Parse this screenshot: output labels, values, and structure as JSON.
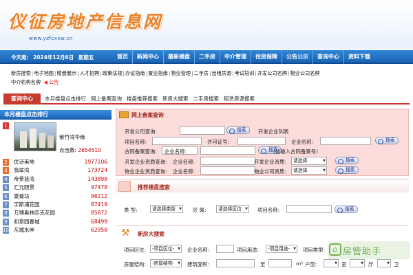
{
  "header": {
    "logo_text": "仪征房地产信息网",
    "url": "www.yzfcxxw.cn"
  },
  "topbar": {
    "today_label": "今天是:",
    "date": "2024年12月6日",
    "weekday": "星期五",
    "nav": [
      "首页",
      "新闻中心",
      "最新楼盘",
      "二手房",
      "中介管理",
      "住房保障",
      "公告公示",
      "查询中心",
      "资料下载"
    ]
  },
  "links": {
    "row1": [
      "新房搜索",
      "电子地图",
      "楼盘展示",
      "人才招聘",
      "政策法规",
      "办证指南",
      "置业指南",
      "物业管理",
      "二手房",
      "出租房源",
      "考试培训",
      "开发公司名牌",
      "物业公司名牌"
    ],
    "row2_first": "中介机构名牌",
    "notice": "公告"
  },
  "search_tabs": {
    "active": "查询中心",
    "tabs": [
      "本月楼盘点击排行",
      "网上备案查询",
      "楼盘推荐搜索",
      "新房大搜索",
      "二手房搜索",
      "租赁房源搜索"
    ]
  },
  "ranking": {
    "title": "本月楼盘点击排行",
    "featured": {
      "rank": "1",
      "name": "紫竹湾华缘",
      "clicks_label": "点击数:",
      "clicks": "2654510"
    },
    "items": [
      {
        "rank": "2",
        "name": "优诗美地",
        "count": "1977106"
      },
      {
        "rank": "3",
        "name": "翡翠湾",
        "count": "173724"
      },
      {
        "rank": "4",
        "name": "帝景蓝湾",
        "count": "143898"
      },
      {
        "rank": "5",
        "name": "汇元颐景",
        "count": "97478"
      },
      {
        "rank": "6",
        "name": "豪菊坊",
        "count": "96212"
      },
      {
        "rank": "7",
        "name": "宇斯浦花园",
        "count": "87419"
      },
      {
        "rank": "8",
        "name": "万博奥林匹克花园",
        "count": "85872"
      },
      {
        "rank": "9",
        "name": "和景园春城",
        "count": "68499"
      },
      {
        "rank": "10",
        "name": "东城水岸",
        "count": "62958"
      }
    ]
  },
  "backup_search": {
    "title": "网上备案查询",
    "dev_company_label": "开发公司查询:",
    "search_btn": "搜索",
    "dev_list": "开发企业列表",
    "project_label": "项目名称:",
    "permit_label": "许可证号:",
    "company_label": "企业名称:",
    "contract_label": "合同备案查询:",
    "contract_company_label": "企业名称:",
    "contract_hint": "(请输入合同备案号)",
    "dev_qual_label": "开发企业资质查询:",
    "dev_qual_company": "企业名称:",
    "dev_qual_level_label": "开发企业资质:",
    "dev_qual_select": "请选择",
    "prop_qual_label": "物业企业资质查询:",
    "prop_qual_company": "企业名称:",
    "prop_qual_level_label": "物业公司资质:",
    "prop_qual_select": "请选择"
  },
  "recommend_search": {
    "title": "推荐楼盘搜索",
    "type_label": "类    型:",
    "type_select": "请选择类型",
    "area_label": "区    属:",
    "area_select": "请选择区位",
    "project_label": "项目名称:",
    "search_btn": "搜索"
  },
  "new_search": {
    "title": "新房大搜索",
    "area_label": "项目区位:",
    "area_select": "-项目区位-",
    "company_label": "企业名称:",
    "usage_label": "项目用途:",
    "usage_select": "-项目用途-",
    "type_label": "项目类型:",
    "structure_label": "房屋结构:",
    "structure_select": "-房屋结构-",
    "area_size_label": "建筑面积:",
    "to_label": "至",
    "unit_label": "m²",
    "layout_label": "户型:",
    "room_label": "室",
    "hall_label": "厅",
    "bath_label": "卫"
  },
  "watermark": "房管助手"
}
